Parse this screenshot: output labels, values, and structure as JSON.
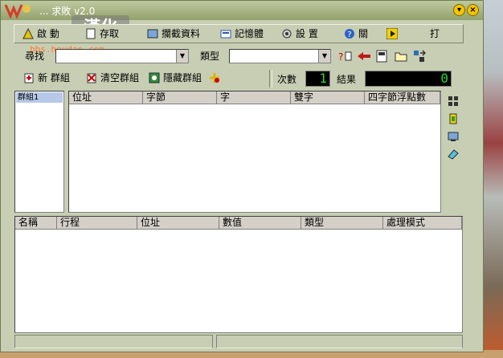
{
  "window": {
    "title": "... 求敗 v2.0",
    "watermark": "漢化",
    "watermark_url": "bbs.houdao.com"
  },
  "menu": [
    {
      "label": "啟 動",
      "icon": "triangle-icon"
    },
    {
      "label": "存取",
      "icon": "file-icon"
    },
    {
      "label": "攔截資料",
      "icon": "book-icon"
    },
    {
      "label": "記憶體",
      "icon": "memory-icon"
    },
    {
      "label": "設 置",
      "icon": "gear-icon"
    },
    {
      "label": "關",
      "icon": "help-icon"
    },
    {
      "label": "",
      "icon": "play-icon"
    },
    {
      "label": "打"
    }
  ],
  "search": {
    "label": "尋找",
    "value": "",
    "type_label": "類型",
    "type_value": ""
  },
  "toolbar": {
    "btn1": "新 群組",
    "btn2": "清空群組",
    "btn3": "隱藏群組",
    "count_label": "次數",
    "count_value": "1",
    "result_label": "結果",
    "result_value": "0"
  },
  "group_list": [
    "群組1"
  ],
  "top_table": {
    "headers": [
      "位址",
      "字節",
      "字",
      "雙字",
      "四字節浮點數"
    ]
  },
  "bottom_table": {
    "headers": [
      "名稱",
      "行程",
      "位址",
      "數值",
      "類型",
      "處理模式"
    ]
  }
}
